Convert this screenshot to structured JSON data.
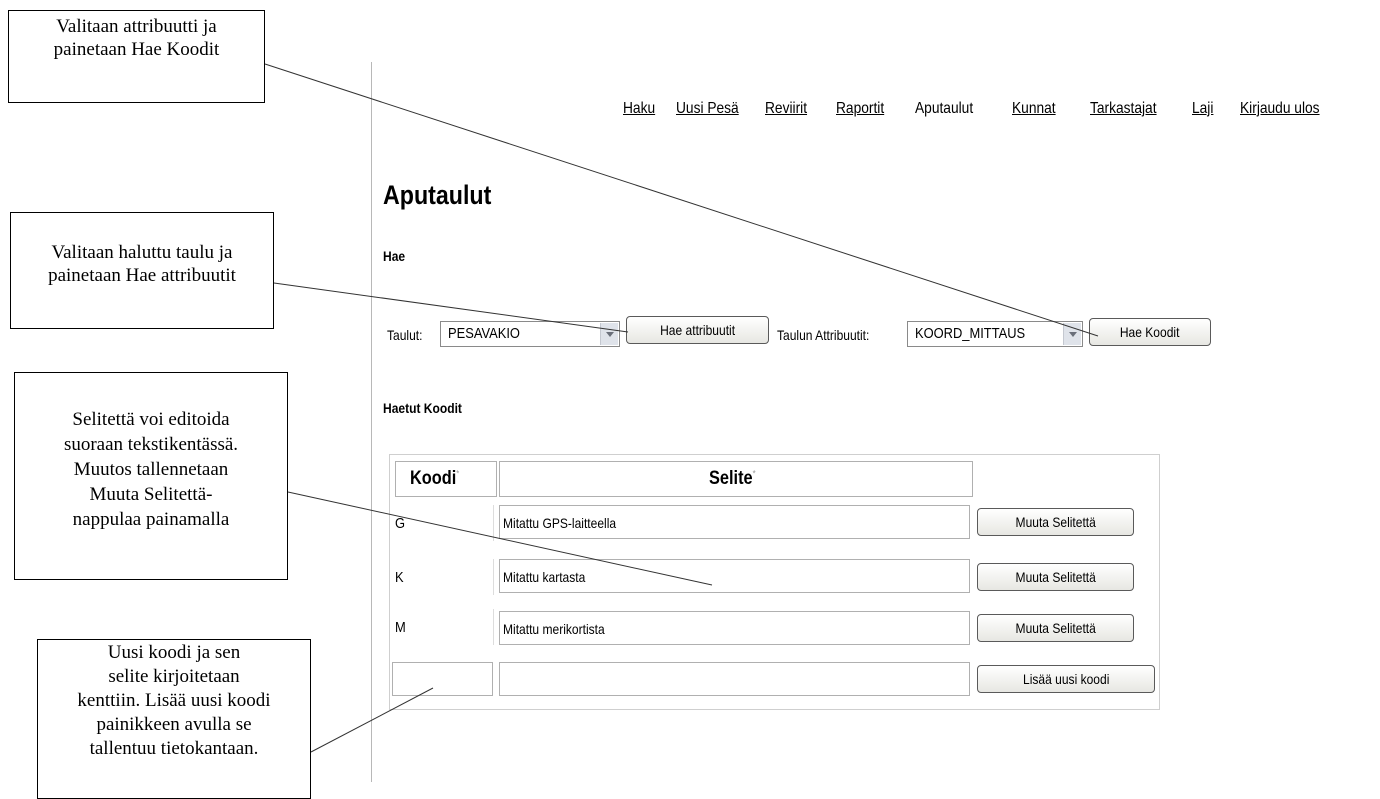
{
  "nav": {
    "items": [
      {
        "label": "Haku",
        "active": false
      },
      {
        "label": "Uusi Pesä",
        "active": false
      },
      {
        "label": "Reviirit",
        "active": false
      },
      {
        "label": "Raportit",
        "active": false
      },
      {
        "label": "Aputaulut",
        "active": true
      },
      {
        "label": "Kunnat",
        "active": false
      },
      {
        "label": "Tarkastajat",
        "active": false
      },
      {
        "label": "Laji",
        "active": false
      },
      {
        "label": "Kirjaudu ulos",
        "active": false
      }
    ]
  },
  "page": {
    "title": "Aputaulut",
    "search_heading": "Hae",
    "results_heading": "Haetut Koodit"
  },
  "search": {
    "tables_label": "Taulut:",
    "tables_value": "PESAVAKIO",
    "get_attributes_button": "Hae attribuutit",
    "attributes_label": "Taulun Attribuutit:",
    "attributes_value": "KOORD_MITTAUS",
    "get_codes_button": "Hae Koodit"
  },
  "table": {
    "headers": [
      "Koodi",
      "Selite"
    ],
    "header_marker": "*",
    "rows": [
      {
        "code": "G",
        "description": "Mitattu GPS-laitteella",
        "button": "Muuta Selitettä"
      },
      {
        "code": "K",
        "description": "Mitattu kartasta",
        "button": "Muuta Selitettä"
      },
      {
        "code": "M",
        "description": "Mitattu merikortista",
        "button": "Muuta Selitettä"
      }
    ],
    "new_row": {
      "code": "",
      "description": "",
      "button": "Lisää uusi koodi"
    }
  },
  "callouts": {
    "c1": [
      "Valitaan attribuutti ja",
      "painetaan Hae Koodit"
    ],
    "c2": [
      "Valitaan haluttu taulu ja",
      "painetaan Hae attribuutit"
    ],
    "c3": [
      "Selitettä voi editoida",
      "suoraan tekstikentässä.",
      "Muutos tallennetaan",
      "Muuta Selitettä-",
      "nappulaa painamalla"
    ],
    "c4": [
      "Uusi koodi ja sen",
      "selite kirjoitetaan",
      "kenttiin. Lisää uusi koodi",
      "painikkeen avulla se",
      "tallentuu tietokantaan."
    ]
  }
}
